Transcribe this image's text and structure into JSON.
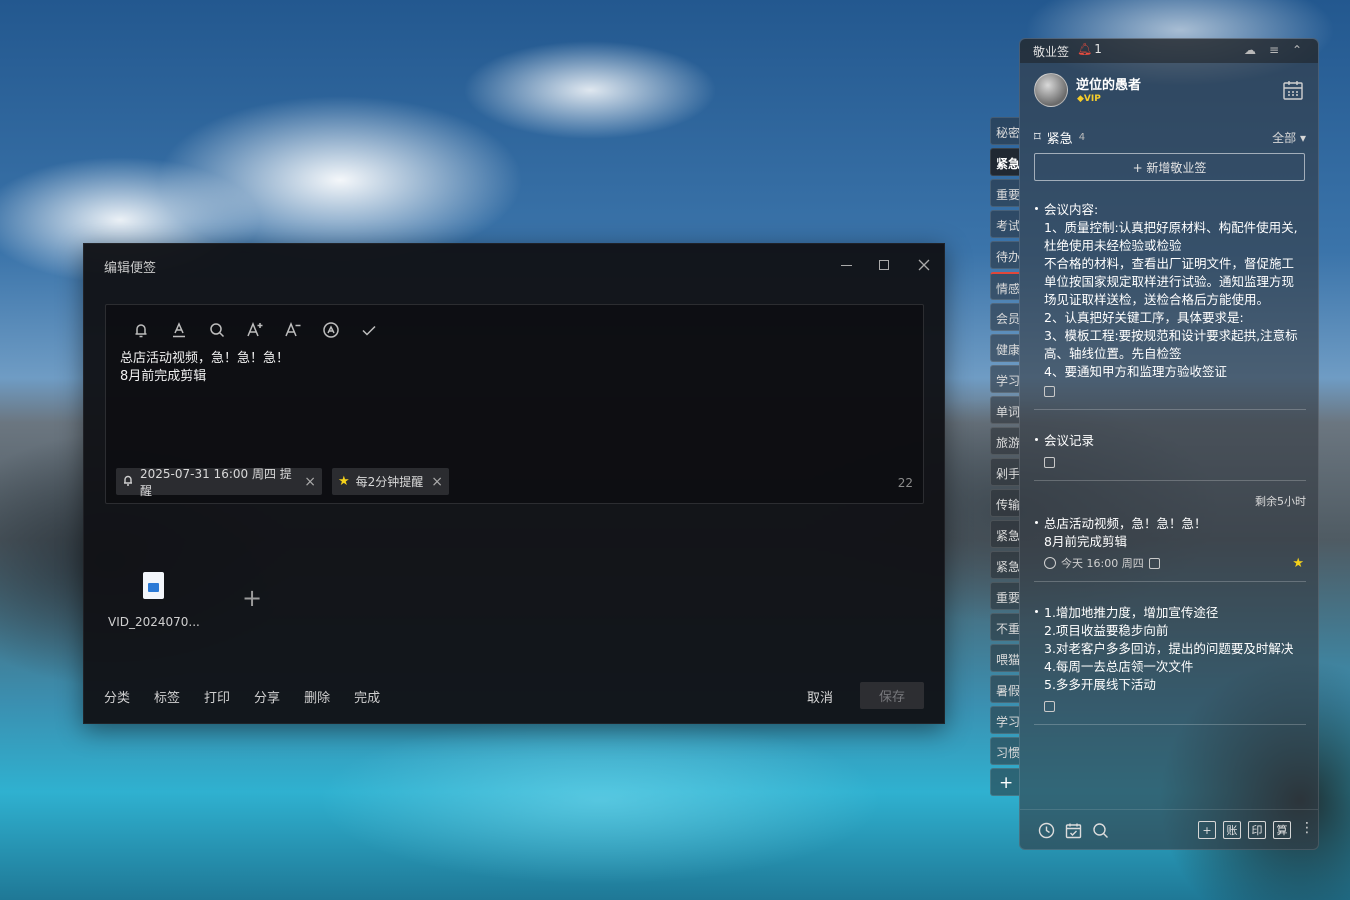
{
  "editor": {
    "title": "编辑便签",
    "content_lines": [
      "总店活动视频，急！急！急！",
      "8月前完成剪辑"
    ],
    "reminder_chip": "2025-07-31 16:00 周四 提醒",
    "repeat_chip": "每2分钟提醒",
    "char_count": "22",
    "attachment_name": "VID_2024070...",
    "add_attachment": "+",
    "actions": [
      "分类",
      "标签",
      "打印",
      "分享",
      "删除",
      "完成"
    ],
    "cancel_label": "取消",
    "save_label": "保存"
  },
  "tabs": [
    {
      "label": "秘密"
    },
    {
      "label": "紧急"
    },
    {
      "label": "重要"
    },
    {
      "label": "考试"
    },
    {
      "label": "待办"
    },
    {
      "label": "情感"
    },
    {
      "label": "会员"
    },
    {
      "label": "健康"
    },
    {
      "label": "学习"
    },
    {
      "label": "单词"
    },
    {
      "label": "旅游"
    },
    {
      "label": "剁手"
    },
    {
      "label": "传输"
    },
    {
      "label": "紧急"
    },
    {
      "label": "紧急"
    },
    {
      "label": "重要"
    },
    {
      "label": "不重"
    },
    {
      "label": "喂猫"
    },
    {
      "label": "暑假"
    },
    {
      "label": "学习"
    },
    {
      "label": "习惯"
    }
  ],
  "tab_add": "+",
  "panel": {
    "app_title": "敬业签",
    "notif_count": "1",
    "user_name": "逆位的愚者",
    "vip_label": "VIP",
    "category": "紧急",
    "category_count": "4",
    "filter": "全部",
    "new_note": "+ 新增敬业签",
    "notes": [
      {
        "lines": [
          "会议内容:",
          "1、质量控制:认真把好原材料、构配件使用关,杜绝使用未经检验或检验",
          "不合格的材料，查看出厂证明文件，督促施工单位按国家规定取样进行试验。通知监理方现场见证取样送检，送检合格后方能使用。",
          "2、认真把好关键工序，具体要求是:",
          "3、模板工程:要按规范和设计要求起拱,注意标高、轴线位置。先自检签",
          "4、要通知甲方和监理方验收签证"
        ]
      },
      {
        "lines": [
          "会议记录"
        ]
      },
      {
        "remaining": "剩余5小时",
        "lines": [
          "总店活动视频，急！急！急！",
          "8月前完成剪辑"
        ],
        "time": "今天 16:00 周四"
      },
      {
        "lines": [
          "1.增加地推力度，增加宣传途径",
          "2.项目收益要稳步向前",
          "3.对老客户多多回访，提出的问题要及时解决",
          "4.每周一去总店领一次文件",
          "5.多多开展线下活动"
        ]
      }
    ],
    "footer_boxes": [
      "+",
      "账",
      "印",
      "算"
    ],
    "footer_more": "⋮"
  }
}
